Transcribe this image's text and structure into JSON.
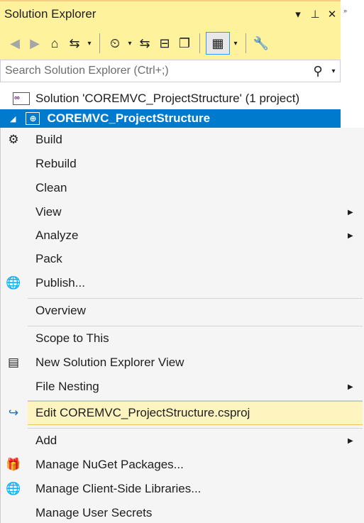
{
  "window": {
    "title": "Solution Explorer",
    "controls": {
      "dropdown": "▾",
      "pin": "⊥",
      "close": "✕"
    },
    "overflow": "›› "
  },
  "toolbar": {
    "back_icon": "◀",
    "forward_icon": "▶",
    "home_icon": "⌂",
    "switch_views_icon": "⇆",
    "history_icon": "⏲",
    "sync_icon": "⇆",
    "collapse_icon": "⊟",
    "show_all_icon": "❐",
    "preview_icon": "▦",
    "properties_icon": "🔧",
    "caret": "▾"
  },
  "search": {
    "placeholder": "Search Solution Explorer (Ctrl+;)",
    "value": "",
    "search_icon": "⚲",
    "options_caret": "▾"
  },
  "tree": {
    "solution_label": "Solution 'COREMVC_ProjectStructure' (1 project)",
    "project_label": "COREMVC_ProjectStructure",
    "expander": "◢"
  },
  "menu": {
    "items": [
      {
        "label": "Build",
        "icon": "⚙",
        "submenu": false
      },
      {
        "label": "Rebuild",
        "icon": "",
        "submenu": false
      },
      {
        "label": "Clean",
        "icon": "",
        "submenu": false
      },
      {
        "label": "View",
        "icon": "",
        "submenu": true
      },
      {
        "label": "Analyze",
        "icon": "",
        "submenu": true
      },
      {
        "label": "Pack",
        "icon": "",
        "submenu": false
      },
      {
        "label": "Publish...",
        "icon": "🌐",
        "submenu": false
      },
      {
        "label": "Overview",
        "icon": "",
        "submenu": false
      },
      {
        "label": "Scope to This",
        "icon": "",
        "submenu": false
      },
      {
        "label": "New Solution Explorer View",
        "icon": "▤",
        "submenu": false
      },
      {
        "label": "File Nesting",
        "icon": "",
        "submenu": true
      },
      {
        "label": "Edit COREMVC_ProjectStructure.csproj",
        "icon": "↪",
        "submenu": false
      },
      {
        "label": "Add",
        "icon": "",
        "submenu": true
      },
      {
        "label": "Manage NuGet Packages...",
        "icon": "🎁",
        "submenu": false
      },
      {
        "label": "Manage Client-Side Libraries...",
        "icon": "🌐",
        "submenu": false
      },
      {
        "label": "Manage User Secrets",
        "icon": "",
        "submenu": false
      }
    ],
    "submenu_arrow": "▶"
  }
}
